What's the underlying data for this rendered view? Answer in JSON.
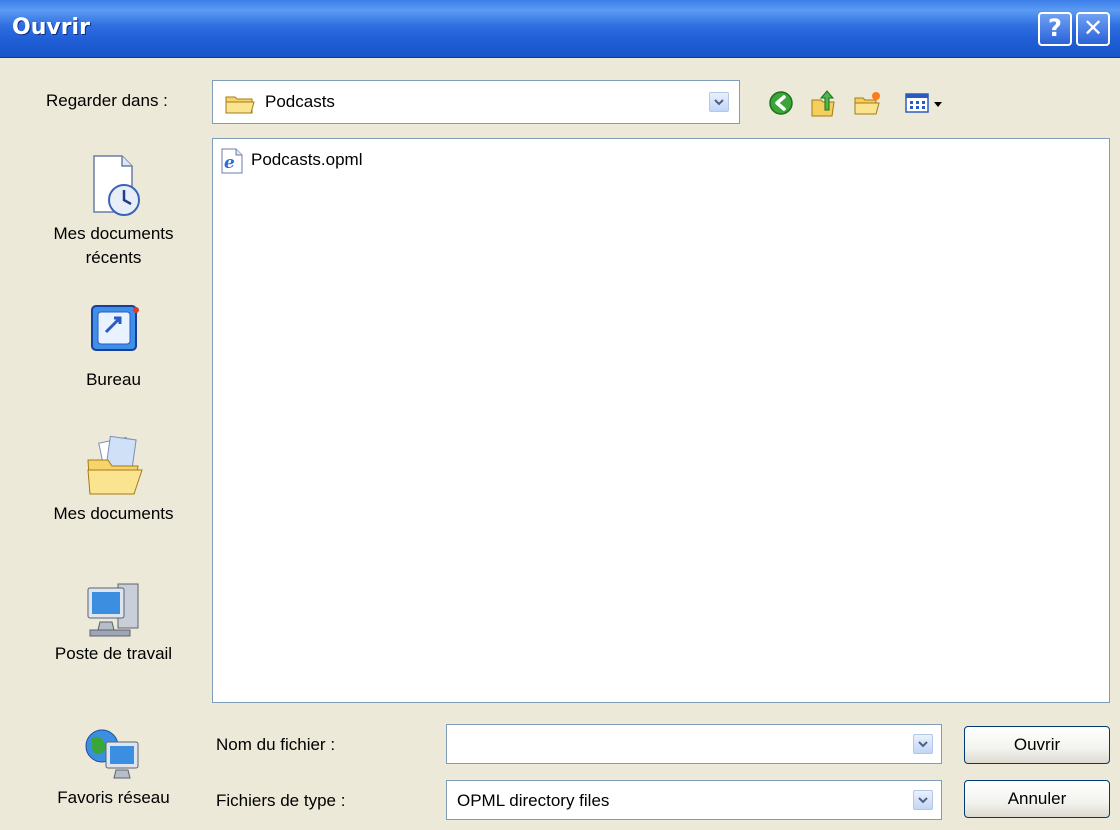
{
  "window": {
    "title": "Ouvrir",
    "help_label": "?",
    "close_label": "✕"
  },
  "lookin": {
    "label": "Regarder dans :",
    "value": "Podcasts"
  },
  "toolbar": {
    "icons": [
      "back-icon",
      "up-folder-icon",
      "new-folder-icon",
      "view-menu-icon"
    ]
  },
  "places": [
    {
      "label": "Mes documents récents",
      "icon": "recent-documents-icon"
    },
    {
      "label": "Bureau",
      "icon": "desktop-icon"
    },
    {
      "label": "Mes documents",
      "icon": "my-documents-icon"
    },
    {
      "label": "Poste de travail",
      "icon": "my-computer-icon"
    },
    {
      "label": "Favoris réseau",
      "icon": "network-places-icon"
    }
  ],
  "files": [
    {
      "name": "Podcasts.opml",
      "icon": "ie-document-icon"
    }
  ],
  "filename": {
    "label": "Nom du fichier :",
    "value": ""
  },
  "filetype": {
    "label": "Fichiers de type :",
    "value": "OPML directory files"
  },
  "buttons": {
    "open": "Ouvrir",
    "cancel": "Annuler"
  },
  "colors": {
    "title_bar": "#245edb",
    "dialog_bg": "#ece9d8",
    "border": "#7f9db9"
  }
}
